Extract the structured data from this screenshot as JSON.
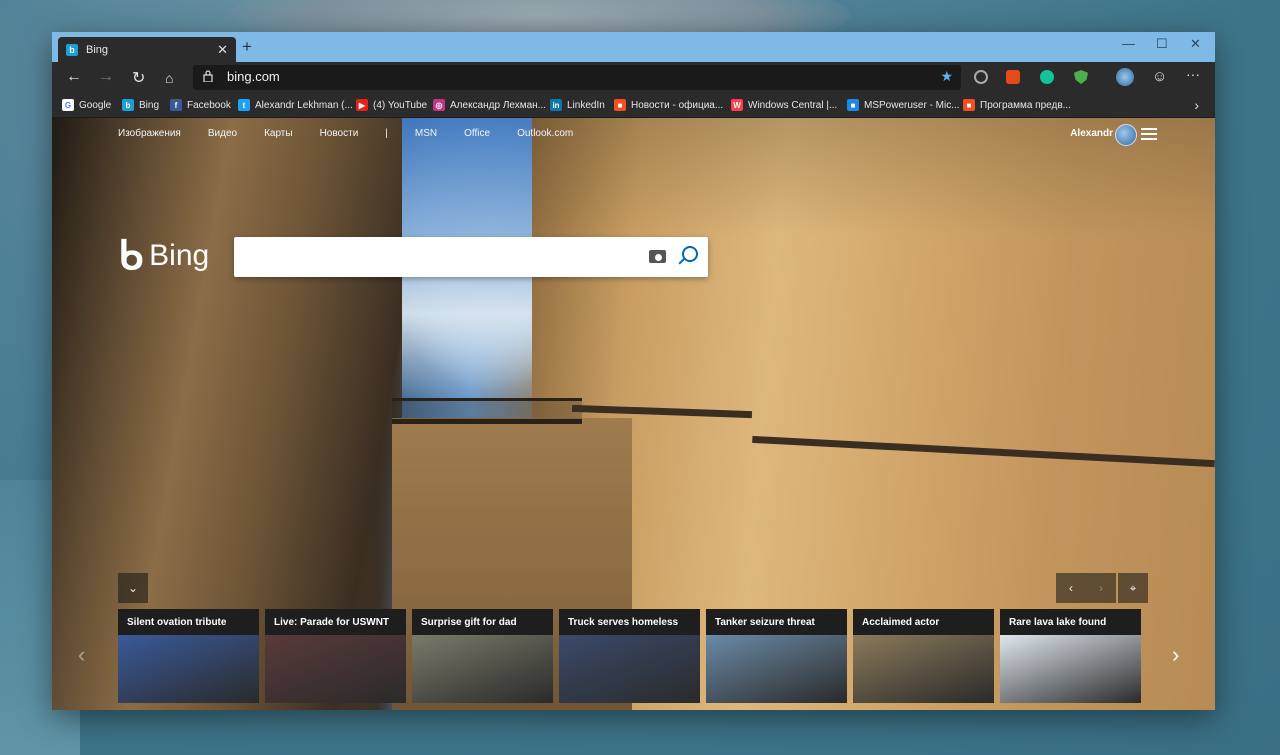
{
  "browser": {
    "tab_title": "Bing",
    "tab_favicon": "b",
    "url": "bing.com"
  },
  "favorites": [
    {
      "label": "Google",
      "icon": "google-icon",
      "color": "#ffffff",
      "glyph": "G"
    },
    {
      "label": "Bing",
      "icon": "bing-icon",
      "color": "#1a9fd8",
      "glyph": "b"
    },
    {
      "label": "Facebook",
      "icon": "facebook-icon",
      "color": "#3b5998",
      "glyph": "f"
    },
    {
      "label": "Alexandr Lekhman (...",
      "icon": "twitter-icon",
      "color": "#1da1f2",
      "glyph": "t"
    },
    {
      "label": "(4) YouTube",
      "icon": "youtube-icon",
      "color": "#e62117",
      "glyph": "▶"
    },
    {
      "label": "Александр Лехман...",
      "icon": "instagram-icon",
      "color": "#c13584",
      "glyph": "◎"
    },
    {
      "label": "LinkedIn",
      "icon": "linkedin-icon",
      "color": "#0e76a8",
      "glyph": "in"
    },
    {
      "label": "Новости - официа...",
      "icon": "microsoft-icon",
      "color": "#f25022",
      "glyph": "■"
    },
    {
      "label": "Windows Central |...",
      "icon": "windows-central-icon",
      "color": "#ff3c50",
      "glyph": "W"
    },
    {
      "label": "MSPoweruser - Mic...",
      "icon": "mspoweruser-icon",
      "color": "#1e88e5",
      "glyph": "■"
    },
    {
      "label": "Программа предв...",
      "icon": "microsoft-icon",
      "color": "#f25022",
      "glyph": "■"
    }
  ],
  "bing": {
    "nav": [
      "Изображения",
      "Видео",
      "Карты",
      "Новости",
      "|",
      "MSN",
      "Office",
      "Outlook.com"
    ],
    "user_name": "Alexandr",
    "logo_text": "Bing",
    "search_placeholder": ""
  },
  "cards": [
    {
      "title": "Silent ovation tribute",
      "color": "#3a5a9a"
    },
    {
      "title": "Live: Parade for USWNT",
      "color": "#5a3a3a"
    },
    {
      "title": "Surprise gift for dad",
      "color": "#7a7a6a"
    },
    {
      "title": "Truck serves homeless",
      "color": "#3a4a6a"
    },
    {
      "title": "Tanker seizure threat",
      "color": "#6a8aa6"
    },
    {
      "title": "Acclaimed actor",
      "color": "#8a7a5a"
    },
    {
      "title": "Rare lava lake found",
      "color": "#dfe7ee"
    }
  ]
}
